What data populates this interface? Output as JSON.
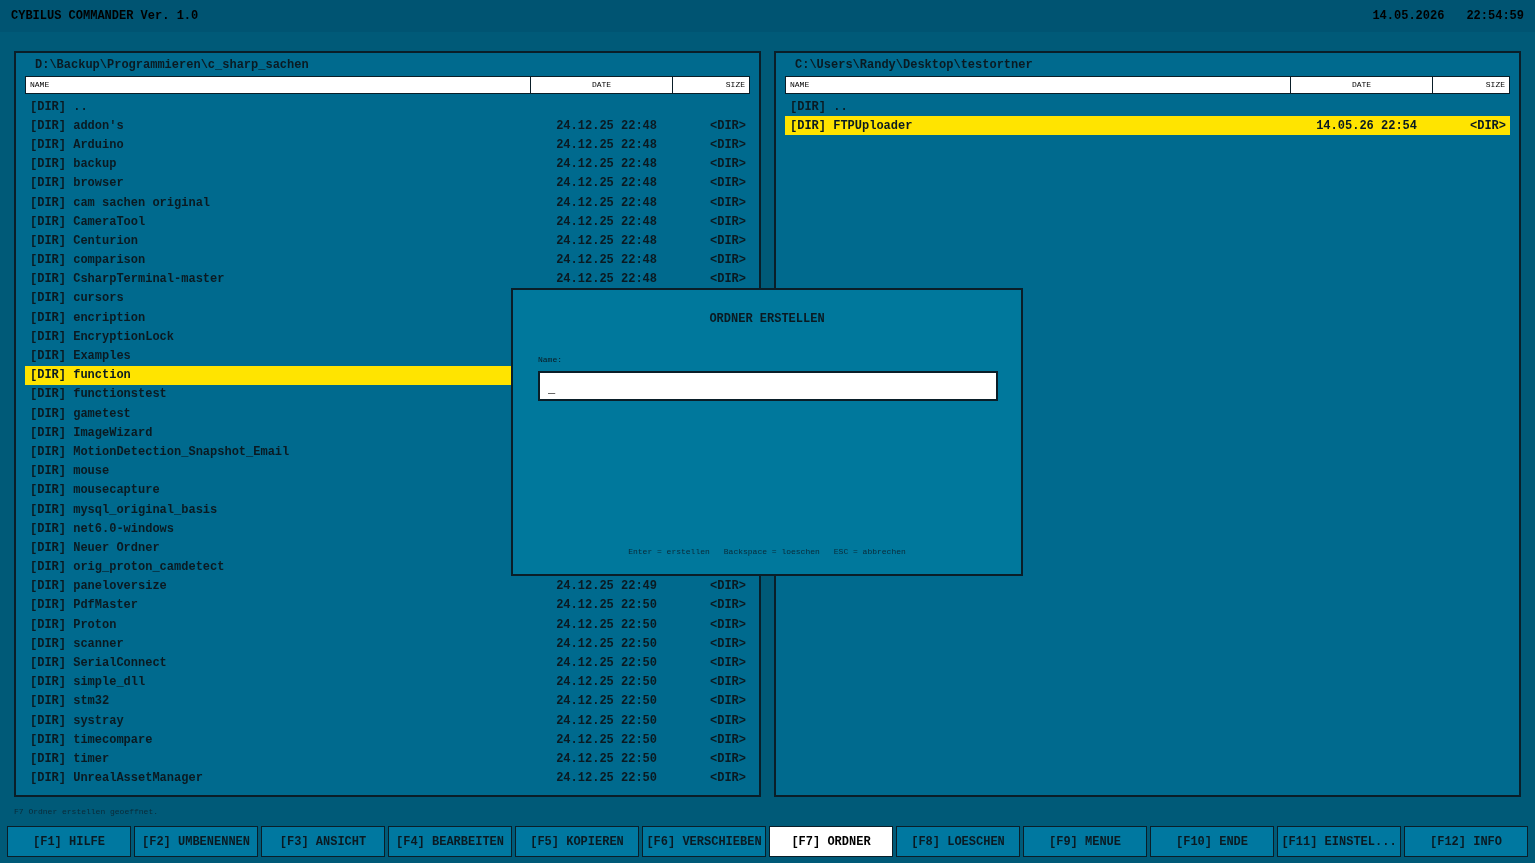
{
  "app": {
    "title": "CYBILUS COMMANDER Ver. 1.0",
    "date": "14.05.2026",
    "time": "22:54:59"
  },
  "panels": [
    {
      "path": "D:\\Backup\\Programmieren\\c_sharp_sachen",
      "columns": [
        "NAME",
        "DATE",
        "SIZE"
      ],
      "rows": [
        {
          "name": "[DIR] ..",
          "selected": false
        },
        {
          "name": "[DIR] addon's",
          "date": "24.12.25 22:48",
          "size": "<DIR>",
          "selected": false
        },
        {
          "name": "[DIR] Arduino",
          "date": "24.12.25 22:48",
          "size": "<DIR>",
          "selected": false
        },
        {
          "name": "[DIR] backup",
          "date": "24.12.25 22:48",
          "size": "<DIR>",
          "selected": false
        },
        {
          "name": "[DIR] browser",
          "date": "24.12.25 22:48",
          "size": "<DIR>",
          "selected": false
        },
        {
          "name": "[DIR] cam sachen original",
          "date": "24.12.25 22:48",
          "size": "<DIR>",
          "selected": false
        },
        {
          "name": "[DIR] CameraTool",
          "date": "24.12.25 22:48",
          "size": "<DIR>",
          "selected": false
        },
        {
          "name": "[DIR] Centurion",
          "date": "24.12.25 22:48",
          "size": "<DIR>",
          "selected": false
        },
        {
          "name": "[DIR] comparison",
          "date": "24.12.25 22:48",
          "size": "<DIR>",
          "selected": false
        },
        {
          "name": "[DIR] CsharpTerminal-master",
          "date": "24.12.25 22:48",
          "size": "<DIR>",
          "selected": false
        },
        {
          "name": "[DIR] cursors",
          "selected": false
        },
        {
          "name": "[DIR] encription",
          "selected": false
        },
        {
          "name": "[DIR] EncryptionLock",
          "selected": false
        },
        {
          "name": "[DIR] Examples",
          "selected": false
        },
        {
          "name": "[DIR] function",
          "selected": true
        },
        {
          "name": "[DIR] functionstest",
          "selected": false
        },
        {
          "name": "[DIR] gametest",
          "selected": false
        },
        {
          "name": "[DIR] ImageWizard",
          "selected": false
        },
        {
          "name": "[DIR] MotionDetection_Snapshot_Email",
          "selected": false
        },
        {
          "name": "[DIR] mouse",
          "selected": false
        },
        {
          "name": "[DIR] mousecapture",
          "selected": false
        },
        {
          "name": "[DIR] mysql_original_basis",
          "selected": false
        },
        {
          "name": "[DIR] net6.0-windows",
          "selected": false
        },
        {
          "name": "[DIR] Neuer Ordner",
          "selected": false
        },
        {
          "name": "[DIR] orig_proton_camdetect",
          "selected": false
        },
        {
          "name": "[DIR] paneloversize",
          "date": "24.12.25 22:49",
          "size": "<DIR>",
          "selected": false
        },
        {
          "name": "[DIR] PdfMaster",
          "date": "24.12.25 22:50",
          "size": "<DIR>",
          "selected": false
        },
        {
          "name": "[DIR] Proton",
          "date": "24.12.25 22:50",
          "size": "<DIR>",
          "selected": false
        },
        {
          "name": "[DIR] scanner",
          "date": "24.12.25 22:50",
          "size": "<DIR>",
          "selected": false
        },
        {
          "name": "[DIR] SerialConnect",
          "date": "24.12.25 22:50",
          "size": "<DIR>",
          "selected": false
        },
        {
          "name": "[DIR] simple_dll",
          "date": "24.12.25 22:50",
          "size": "<DIR>",
          "selected": false
        },
        {
          "name": "[DIR] stm32",
          "date": "24.12.25 22:50",
          "size": "<DIR>",
          "selected": false
        },
        {
          "name": "[DIR] systray",
          "date": "24.12.25 22:50",
          "size": "<DIR>",
          "selected": false
        },
        {
          "name": "[DIR] timecompare",
          "date": "24.12.25 22:50",
          "size": "<DIR>",
          "selected": false
        },
        {
          "name": "[DIR] timer",
          "date": "24.12.25 22:50",
          "size": "<DIR>",
          "selected": false
        },
        {
          "name": "[DIR] UnrealAssetManager",
          "date": "24.12.25 22:50",
          "size": "<DIR>",
          "selected": false
        }
      ]
    },
    {
      "path": "C:\\Users\\Randy\\Desktop\\testortner",
      "columns": [
        "NAME",
        "DATE",
        "SIZE"
      ],
      "rows": [
        {
          "name": "[DIR] ..",
          "selected": false
        },
        {
          "name": "[DIR] FTPUploader",
          "date": "14.05.26 22:54",
          "size": "<DIR>",
          "selected": true
        }
      ]
    }
  ],
  "dialog": {
    "title": "ORDNER ERSTELLEN",
    "label": "Name:",
    "value": "_",
    "hints": [
      "Enter = erstellen",
      "Backspace = loeschen",
      "ESC = abbrechen"
    ]
  },
  "status": "F7 Ordner erstellen geoeffnet.",
  "function_keys": [
    {
      "label": "[F1] HILFE",
      "selected": false
    },
    {
      "label": "[F2] UMBENENNEN",
      "selected": false
    },
    {
      "label": "[F3] ANSICHT",
      "selected": false
    },
    {
      "label": "[F4] BEARBEITEN",
      "selected": false
    },
    {
      "label": "[F5] KOPIEREN",
      "selected": false
    },
    {
      "label": "[F6] VERSCHIEBEN",
      "selected": false
    },
    {
      "label": "[F7] ORDNER",
      "selected": true
    },
    {
      "label": "[F8] LOESCHEN",
      "selected": false
    },
    {
      "label": "[F9] MENUE",
      "selected": false
    },
    {
      "label": "[F10] ENDE",
      "selected": false
    },
    {
      "label": "[F11] EINSTEL...",
      "selected": false
    },
    {
      "label": "[F12] INFO",
      "selected": false
    }
  ]
}
